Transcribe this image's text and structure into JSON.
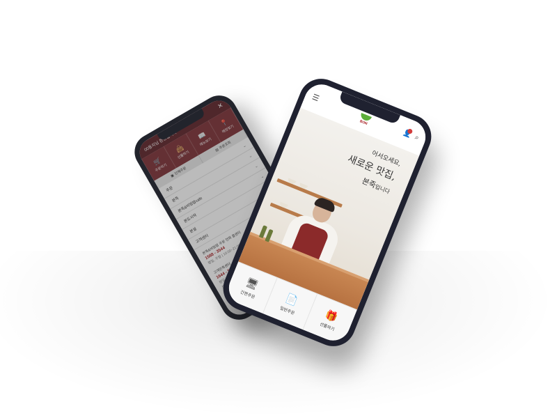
{
  "back_phone": {
    "topbar_text": "00동지님 환영합니다",
    "close_label": "✕",
    "quick_menu": [
      {
        "icon": "cart-icon",
        "glyph": "🛒",
        "label": "주문하기"
      },
      {
        "icon": "bag-icon",
        "glyph": "👜",
        "label": "선물하기"
      },
      {
        "icon": "menu-book-icon",
        "glyph": "📖",
        "label": "메뉴보기"
      },
      {
        "icon": "location-pin-icon",
        "glyph": "📍",
        "label": "매장찾기"
      }
    ],
    "sub_tabs": [
      {
        "icon": "group-order-icon",
        "glyph": "▣",
        "label": "단체주문"
      },
      {
        "icon": "order-check-icon",
        "glyph": "▤",
        "label": "주문조회"
      }
    ],
    "menu_rows": [
      {
        "label": "주문",
        "has_chevron": true
      },
      {
        "label": "본죽",
        "has_chevron": true
      },
      {
        "label": "본죽&비빔밥cafe",
        "has_chevron": true
      },
      {
        "label": "본도시락",
        "has_chevron": true
      },
      {
        "label": "본설",
        "has_chevron": true
      },
      {
        "label": "고객센터",
        "has_chevron": false
      }
    ],
    "info": {
      "line1": "본죽&비빔밥 주문 전화 콜센터",
      "phone1": "1588 - 3544",
      "hours1": "평일, 주말 | 10:00~21:00",
      "line2": "고객만족센터",
      "phone2": "1644 - 5285",
      "hours2a": "평일 | 09:00~18:00",
      "hours2b": "토,일,공휴일 휴무"
    }
  },
  "front_phone": {
    "header": {
      "menu_icon": "☰",
      "logo_text": "BON",
      "user_icon": "👤",
      "search_icon": "⌕"
    },
    "hero": {
      "line1": "어서오세요,",
      "line2": "새로운 맛집,",
      "line3_main": "본죽",
      "line3_small": "입니다"
    },
    "bottom_tabs": [
      {
        "icon": "monitor-icon",
        "glyph": "🖥",
        "label": "간편주문"
      },
      {
        "icon": "document-icon",
        "glyph": "📄",
        "label": "일반주문"
      },
      {
        "icon": "gift-icon",
        "glyph": "🎁",
        "label": "선물하기"
      }
    ]
  },
  "colors": {
    "brand_dark_red": "#7a2a30",
    "brand_red": "#a4161a",
    "logo_green": "#5cae3a",
    "phone_frame": "#1f2130"
  }
}
